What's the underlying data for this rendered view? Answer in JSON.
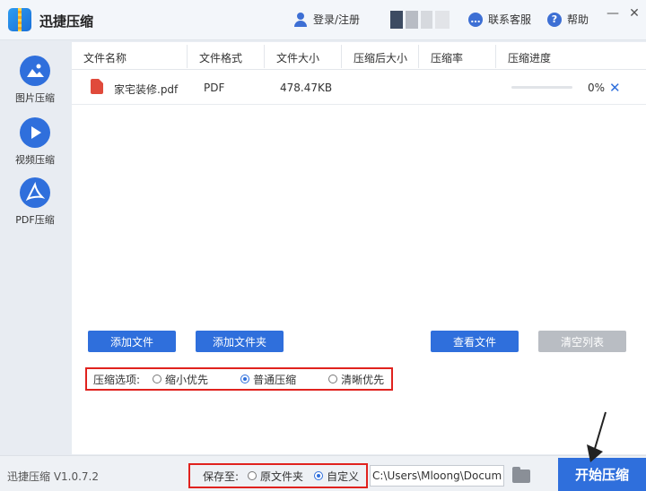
{
  "app": {
    "title": "迅捷压缩",
    "login_label": "登录/注册",
    "service_label": "联系客服",
    "help_label": "帮助",
    "help_icon_glyph": "?"
  },
  "window_controls": {
    "minimize": "—",
    "close": "✕"
  },
  "sidebar": {
    "items": [
      {
        "label": "图片压缩",
        "icon": "image-icon"
      },
      {
        "label": "视频压缩",
        "icon": "play-icon"
      },
      {
        "label": "PDF压缩",
        "icon": "pdf-icon"
      }
    ]
  },
  "table": {
    "headers": [
      "文件名称",
      "文件格式",
      "文件大小",
      "压缩后大小",
      "压缩率",
      "压缩进度"
    ],
    "rows": [
      {
        "name": "家宅装修.pdf",
        "format": "PDF",
        "size": "478.47KB",
        "compressed_size": "",
        "ratio": "",
        "progress_text": "0%",
        "progress_fraction": 0
      }
    ]
  },
  "buttons": {
    "add_file": "添加文件",
    "add_folder": "添加文件夹",
    "view_file": "查看文件",
    "clear_list": "清空列表",
    "start": "开始压缩"
  },
  "compress_options": {
    "label": "压缩选项:",
    "options": [
      "缩小优先",
      "普通压缩",
      "清晰优先"
    ],
    "selected": "普通压缩"
  },
  "save_to": {
    "label": "保存至:",
    "options": [
      "原文件夹",
      "自定义"
    ],
    "selected": "自定义",
    "path": "C:\\Users\\Mloong\\Documents"
  },
  "version": "迅捷压缩 V1.0.7.2",
  "colors": {
    "accent": "#2f6fdc",
    "highlight_box": "#e0221e",
    "disabled": "#b9bdc3"
  }
}
